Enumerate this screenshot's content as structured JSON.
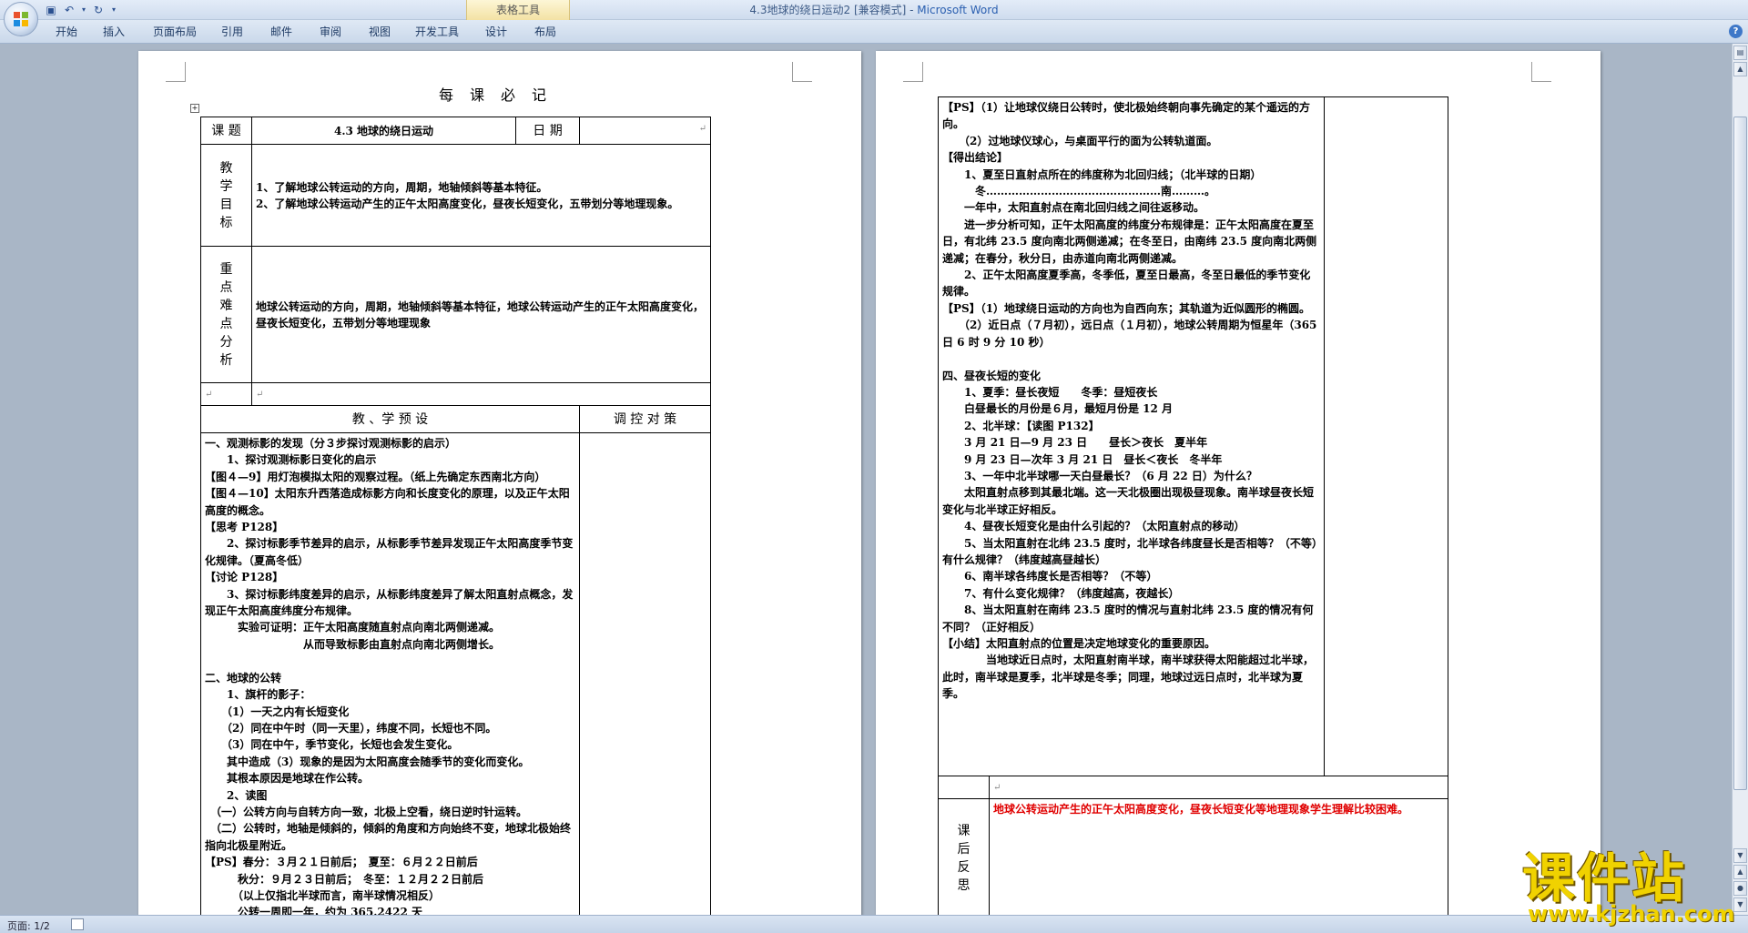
{
  "window": {
    "title": "4.3地球的绕日运动2 [兼容模式]",
    "app_name": "Microsoft Word",
    "context_tools_label": "表格工具"
  },
  "ribbon": {
    "tabs": [
      "开始",
      "插入",
      "页面布局",
      "引用",
      "邮件",
      "审阅",
      "视图",
      "开发工具",
      "设计",
      "布局"
    ]
  },
  "status": {
    "page": "页面: 1/2"
  },
  "watermark": {
    "cn": "课件站",
    "url": "www.kjzhan.com"
  },
  "page1": {
    "title": "每课必记",
    "row1": {
      "label": "课 题",
      "topic": "4.3  地球的绕日运动",
      "date_label": "日 期"
    },
    "goals_label": [
      "教",
      "学",
      "目",
      "标"
    ],
    "goals": [
      "1、了解地球公转运动的方向，周期，地轴倾斜等基本特征。",
      "2、了解地球公转运动产生的正午太阳高度变化，昼夜长短变化，五带划分等地理现象。"
    ],
    "key_label": [
      "重",
      "点",
      "难",
      "点",
      "分",
      "析"
    ],
    "key_text": "地球公转运动的方向，周期，地轴倾斜等基本特征，地球公转运动产生的正午太阳高度变化，昼夜长短变化，五带划分等地理现象",
    "plan_header": "教 、学 预 设",
    "control_header": "调 控 对 策",
    "plan_lines": [
      "一、观测标影的发现（分３步探讨观测标影的启示）",
      "　　1、探讨观测标影日变化的启示",
      "【图４—9】用灯泡模拟太阳的观察过程。（纸上先确定东西南北方向）",
      "【图４—10】太阳东升西落造成标影方向和长度变化的原理，以及正午太阳高度的概念。",
      "【思考 P128】",
      "　　2、探讨标影季节差异的启示，从标影季节差异发现正午太阳高度季节变化规律。（夏高冬低）",
      "【讨论 P128】",
      "　　3、探讨标影纬度差异的启示，从标影纬度差异了解太阳直射点概念，发现正午太阳高度纬度分布规律。",
      "　　　实验可证明：正午太阳高度随直射点向南北两侧递减。",
      "　　　　　　　　　从而导致标影由直射点向南北两侧增长。",
      "",
      "二、地球的公转",
      "　　1、旗杆的影子：",
      "　　（1）一天之内有长短变化",
      "　　（2）同在中午时（同一天里），纬度不同，长短也不同。",
      "　　（3）同在中午，季节变化，长短也会发生变化。",
      "　　其中造成（3）现象的是因为太阳高度会随季节的变化而变化。",
      "　　其根本原因是地球在作公转。",
      "　　2、读图",
      "　（一）公转方向与自转方向一致，北极上空看，绕日逆时针运转。",
      "　（二）公转时，地轴是倾斜的，倾斜的角度和方向始终不变，地球北极始终指向北极星附近。",
      "【PS】春分：３月２１日前后；　夏至：６月２２日前后",
      "　　　秋分：９月２３日前后；　冬至：１２月２２日前后",
      "　　　（以上仅指北半球而言，南半球情况相反）",
      "　　　公转一周即一年，约为 365.2422 天"
    ]
  },
  "page2": {
    "lines": [
      "【PS】（1）让地球仪绕日公转时，使北极始终朝向事先确定的某个遥远的方向。",
      "　　（2）过地球仪球心，与桌面平行的面为公转轨道面。",
      "【得出结论】",
      "　　1、夏至日直射点所在的纬度称为北回归线；（北半球的日期）",
      "　　　冬…………………………………………南………。",
      "　　一年中，太阳直射点在南北回归线之间往返移动。",
      "　　进一步分析可知，正午太阳高度的纬度分布规律是：正午太阳高度在夏至日，有北纬 23.5 度向南北两侧递减；在冬至日，由南纬 23.5 度向南北两侧递减；在春分，秋分日，由赤道向南北两侧递减。",
      "　　2、正午太阳高度夏季高，冬季低，夏至日最高，冬至日最低的季节变化规律。",
      "【PS】（1）地球绕日运动的方向也为自西向东；其轨道为近似圆形的椭圆。",
      "　　（2）近日点（７月初），远日点（１月初），地球公转周期为恒星年（365 日 6 时 9 分 10 秒）",
      "",
      "四、昼夜长短的变化",
      "　　1、夏季：昼长夜短　　冬季：昼短夜长",
      "　　白昼最长的月份是６月，最短月份是 12 月",
      "　　2、北半球：【读图 P132】",
      "　　3 月 21 日—9 月 23 日　　昼长＞夜长　夏半年",
      "　　9 月 23 日—次年 3 月 21 日　昼长＜夜长　冬半年",
      "　　3、一年中北半球哪一天白昼最长？（6 月 22 日）为什么？",
      "　　太阳直射点移到其最北端。这一天北极圈出现极昼现象。南半球昼夜长短变化与北半球正好相反。",
      "　　4、昼夜长短变化是由什么引起的？（太阳直射点的移动）",
      "　　5、当太阳直射在北纬 23.5 度时，北半球各纬度昼长是否相等？（不等）有什么规律？（纬度越高昼越长）",
      "　　6、南半球各纬度长是否相等？（不等）",
      "　　7、有什么变化规律？（纬度越高，夜越长）",
      "　　8、当太阳直射在南纬 23.5 度时的情况与直射北纬 23.5 度的情况有何不同？（正好相反）",
      "【小结】太阳直射点的位置是决定地球变化的重要原因。",
      "　　　　当地球近日点时，太阳直射南半球，南半球获得太阳能超过北半球，此时，南半球是夏季，北半球是冬季；同理，地球过远日点时，北半球为夏季。"
    ],
    "reflect_label": [
      "课",
      "后",
      "反",
      "思"
    ],
    "reflect_text": "地球公转运动产生的正午太阳高度变化，昼夜长短变化等地理现象学生理解比较困难。"
  }
}
